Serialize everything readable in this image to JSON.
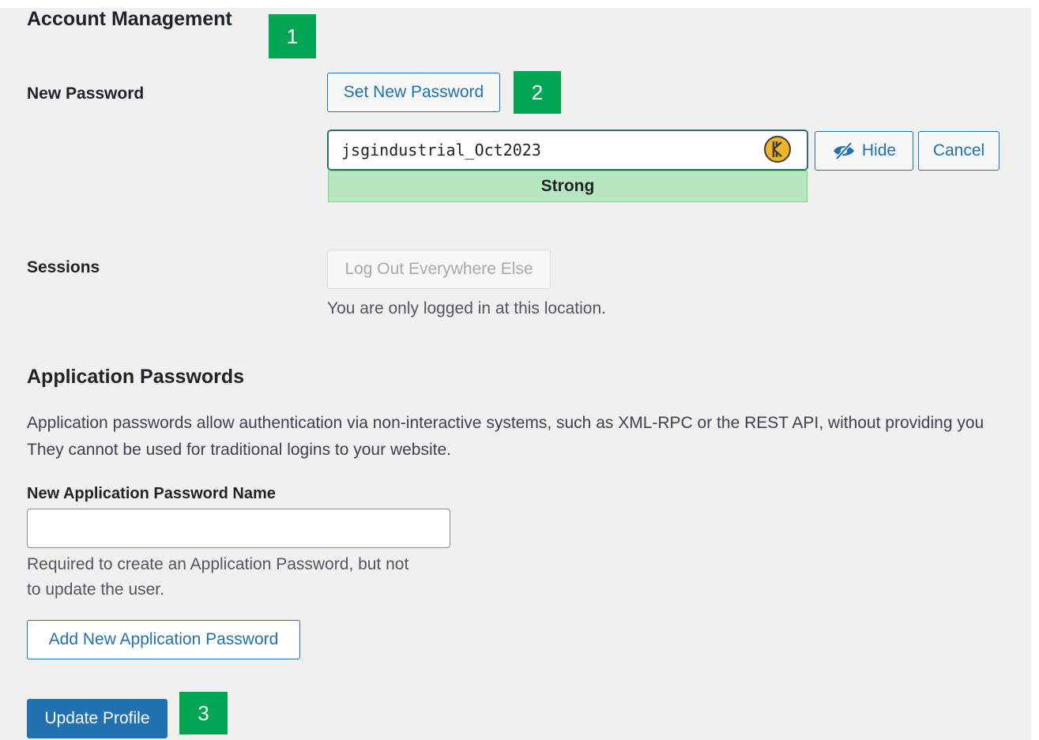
{
  "account": {
    "heading": "Account Management",
    "new_password_label": "New Password",
    "set_new_password_button": "Set New Password",
    "password_value": "jsgindustrial_Oct2023",
    "strength_label": "Strong",
    "hide_button": "Hide",
    "cancel_button": "Cancel",
    "sessions_label": "Sessions",
    "logout_button": "Log Out Everywhere Else",
    "sessions_note": "You are only logged in at this location."
  },
  "app_passwords": {
    "heading": "Application Passwords",
    "description_line1": "Application passwords allow authentication via non-interactive systems, such as XML-RPC or the REST API, without providing you",
    "description_line2": "They cannot be used for traditional logins to your website.",
    "name_label": "New Application Password Name",
    "name_value": "",
    "help_line1": "Required to create an Application Password, but not",
    "help_line2": "to update the user.",
    "add_button": "Add New Application Password"
  },
  "footer": {
    "update_button": "Update Profile"
  },
  "markers": [
    "1",
    "2",
    "3"
  ],
  "colors": {
    "accent": "#2271b1",
    "marker": "#00a651",
    "strength_bg": "#b8e6bf"
  },
  "icons": {
    "password_manager": "keeper-icon",
    "hide": "eye-slash-icon"
  }
}
